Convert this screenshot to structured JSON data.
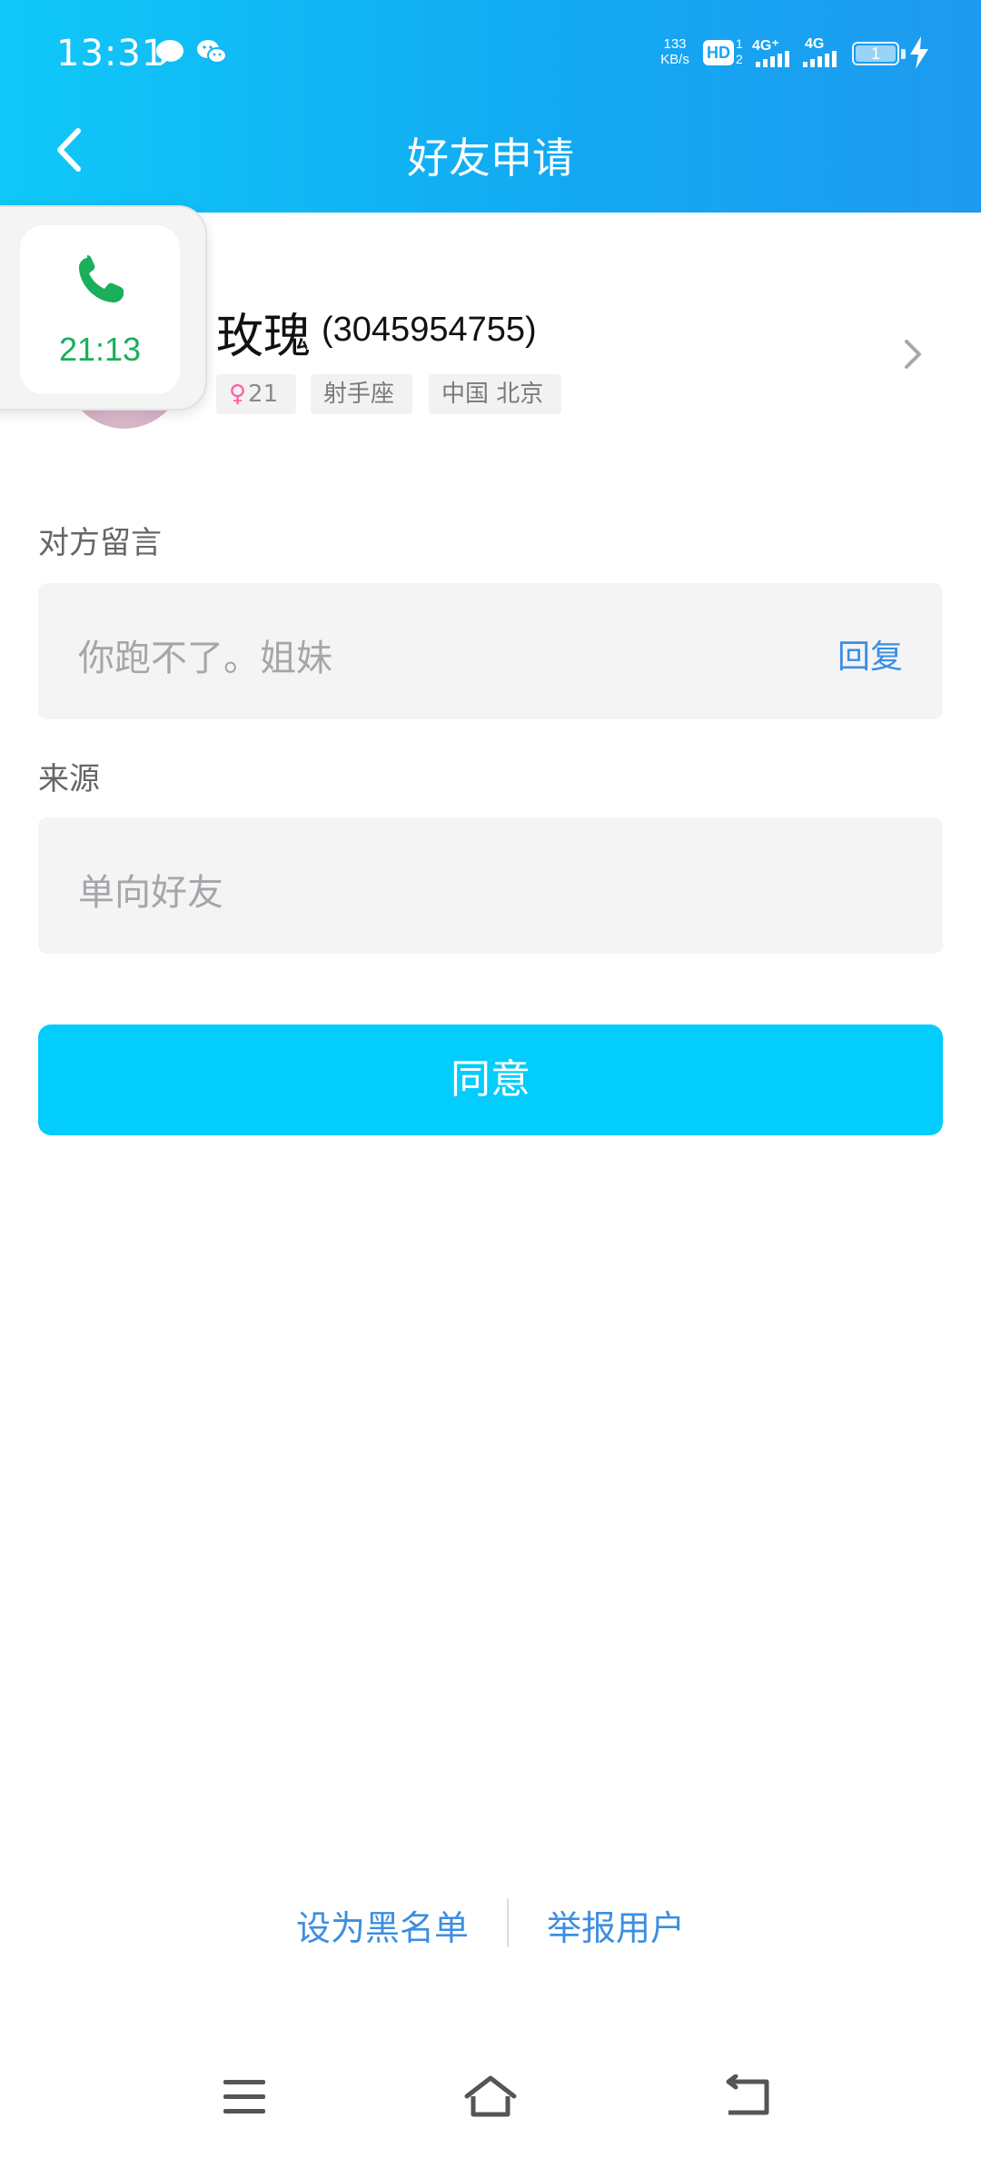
{
  "status_bar": {
    "time": "13:31",
    "network_speed_value": "133",
    "network_speed_unit": "KB/s",
    "hd_label": "HD",
    "hd_sub_top": "1",
    "hd_sub_bottom": "2",
    "sim1_network": "4G⁺",
    "sim2_network": "4G",
    "battery_level": "1",
    "icons": [
      "chat-bubble-icon",
      "wechat-icon",
      "signal-icon",
      "battery-icon",
      "charging-icon"
    ]
  },
  "nav": {
    "title": "好友申请",
    "back_icon": "chevron-left-icon"
  },
  "call_widget": {
    "duration": "21:13",
    "icon": "phone-icon"
  },
  "profile": {
    "name": "玫瑰",
    "id": "(3045954755)",
    "age": "21",
    "gender_icon": "female-icon",
    "zodiac": "射手座",
    "location": "中国 北京"
  },
  "message_section": {
    "label": "对方留言",
    "text": "你跑不了。姐妹",
    "reply_label": "回复"
  },
  "source_section": {
    "label": "来源",
    "text": "单向好友"
  },
  "actions": {
    "agree_label": "同意",
    "blacklist_label": "设为黑名单",
    "report_label": "举报用户"
  },
  "colors": {
    "header_gradient_start": "#0fc8f8",
    "header_gradient_end": "#1e9af0",
    "agree_button": "#03cdfc",
    "link_blue": "#3d8ee0",
    "call_green": "#1aaf5a",
    "female_pink": "#ff5fa2"
  }
}
